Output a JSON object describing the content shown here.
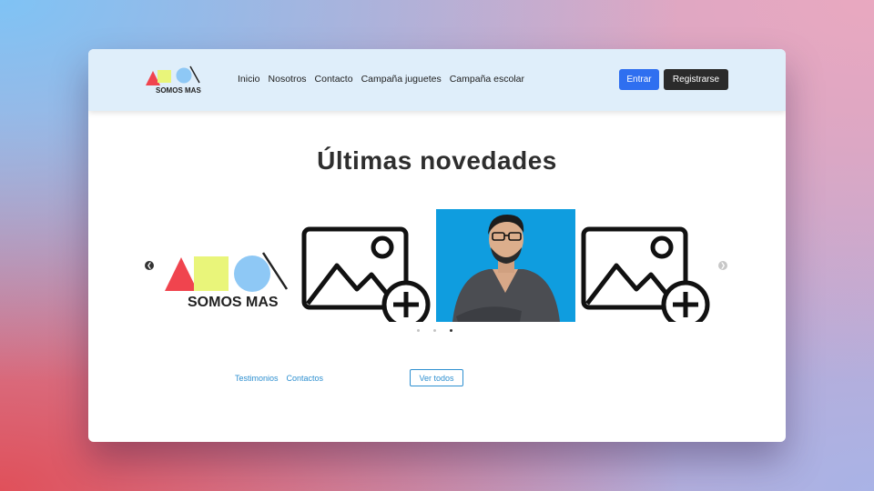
{
  "navbar": {
    "logo_text": "SOMOS MAS",
    "links": [
      "Inicio",
      "Nosotros",
      "Contacto",
      "Campaña juguetes",
      "Campaña escolar"
    ],
    "login_label": "Entrar",
    "register_label": "Registrarse"
  },
  "main": {
    "heading": "Últimas novedades"
  },
  "carousel": {
    "prev_icon": "chevron-left-icon",
    "next_icon": "chevron-right-icon",
    "slides": [
      "somos-mas-logo",
      "image-add-placeholder",
      "person-photo",
      "image-add-placeholder"
    ],
    "dot_count": 3,
    "active_dot": 3
  },
  "footer": {
    "links": [
      "Testimonios",
      "Contactos"
    ],
    "view_all_label": "Ver todos"
  },
  "colors": {
    "navbar_bg": "#dfeefa",
    "primary": "#2f6ff0",
    "dark_button": "#2b2b2b",
    "link": "#2d8fd0",
    "logo_red": "#f0444e",
    "logo_yellow": "#e9f57a",
    "logo_blue": "#8ec8f5",
    "photo_bg": "#0f9ddf"
  }
}
